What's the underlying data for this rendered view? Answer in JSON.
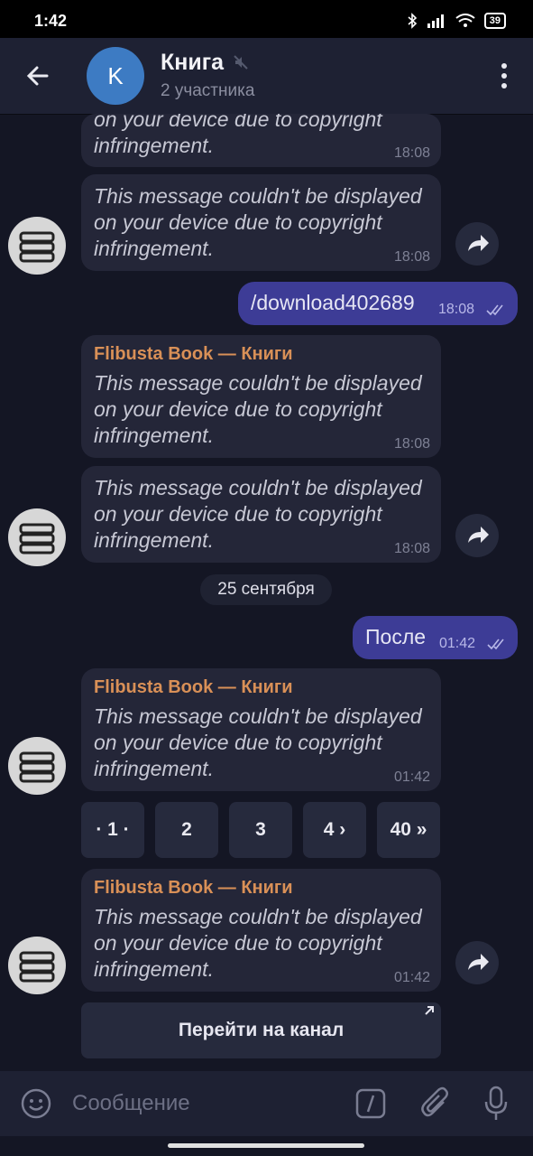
{
  "status_bar": {
    "time": "1:42",
    "battery": "39"
  },
  "header": {
    "title": "Книга",
    "subtitle": "2 участника"
  },
  "messages": [
    {
      "text": "on your device due to copyright infringement.",
      "time": "18:08"
    },
    {
      "text": "This message couldn't be displayed on your device due to copyright infringement.",
      "time": "18:08"
    },
    {
      "text": "/download402689",
      "time": "18:08"
    },
    {
      "sender": "Flibusta Book — Книги",
      "text": "This message couldn't be displayed on your device due to copyright infringement.",
      "time": "18:08"
    },
    {
      "text": "This message couldn't be displayed on your device due to copyright infringement.",
      "time": "18:08"
    },
    {
      "text": "После",
      "time": "01:42"
    },
    {
      "sender": "Flibusta Book — Книги",
      "text": "This message couldn't be displayed on your device due to copyright infringement.",
      "time": "01:42"
    },
    {
      "sender": "Flibusta Book — Книги",
      "text": "This message couldn't be displayed on your device due to copyright infringement.",
      "time": "01:42"
    }
  ],
  "date_separator": "25 сентября",
  "pagination": [
    "· 1 ·",
    "2",
    "3",
    "4 ›",
    "40 »"
  ],
  "channel_button": "Перейти на канал",
  "input": {
    "placeholder": "Сообщение"
  },
  "colors": {
    "background": "#141624",
    "incoming": "#242638",
    "outgoing": "#3d3c96",
    "sender": "#d99057"
  }
}
